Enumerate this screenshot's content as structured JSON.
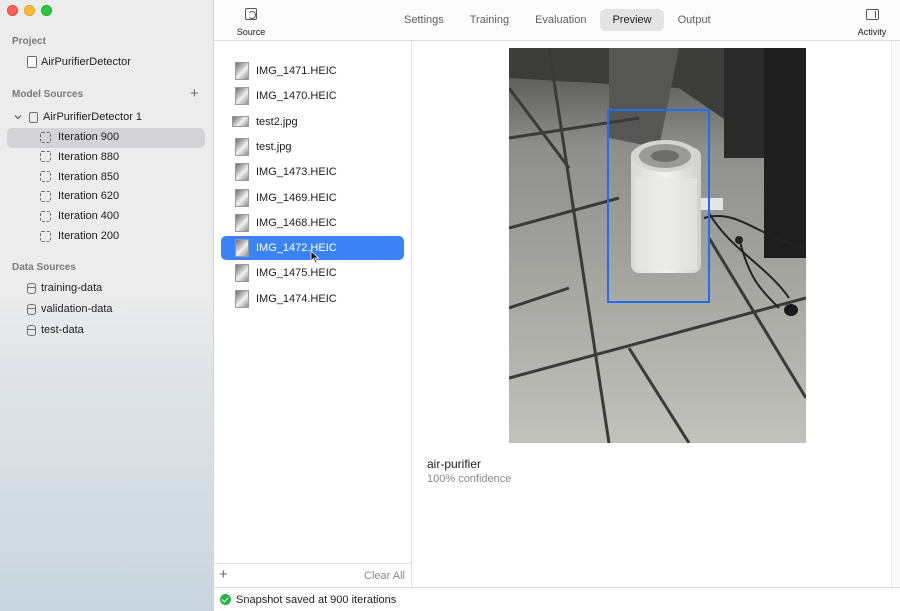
{
  "sidebar": {
    "project_title": "Project",
    "project_name": "AirPurifierDetector",
    "model_sources_title": "Model Sources",
    "add_symbol": "+",
    "model_source": "AirPurifierDetector 1",
    "iterations": [
      {
        "label": "Iteration 900",
        "selected": true
      },
      {
        "label": "Iteration 880",
        "selected": false
      },
      {
        "label": "Iteration 850",
        "selected": false
      },
      {
        "label": "Iteration 620",
        "selected": false
      },
      {
        "label": "Iteration 400",
        "selected": false
      },
      {
        "label": "Iteration 200",
        "selected": false
      }
    ],
    "data_sources_title": "Data Sources",
    "data_sources": [
      "training-data",
      "validation-data",
      "test-data"
    ]
  },
  "toolbar": {
    "source_label": "Source",
    "tabs": [
      "Settings",
      "Training",
      "Evaluation",
      "Preview",
      "Output"
    ],
    "active_tab": "Preview",
    "activity_label": "Activity"
  },
  "files": {
    "items": [
      {
        "name": "IMG_1471.HEIC",
        "selected": false
      },
      {
        "name": "IMG_1470.HEIC",
        "selected": false
      },
      {
        "name": "test2.jpg",
        "selected": false
      },
      {
        "name": "test.jpg",
        "selected": false
      },
      {
        "name": "IMG_1473.HEIC",
        "selected": false
      },
      {
        "name": "IMG_1469.HEIC",
        "selected": false
      },
      {
        "name": "IMG_1468.HEIC",
        "selected": false
      },
      {
        "name": "IMG_1472.HEIC",
        "selected": true
      },
      {
        "name": "IMG_1475.HEIC",
        "selected": false
      },
      {
        "name": "IMG_1474.HEIC",
        "selected": false
      }
    ],
    "add_symbol": "+",
    "clear_all": "Clear All"
  },
  "preview": {
    "label": "air-purifier",
    "confidence": "100% confidence",
    "box_color": "#1d6ef5"
  },
  "status": {
    "text": "Snapshot saved at 900 iterations",
    "icon": "checkmark-circle-icon",
    "color": "#28b446"
  },
  "colors": {
    "selection_blue": "#3b82f6",
    "traffic_red": "#ff5f57",
    "traffic_yellow": "#febc2e",
    "traffic_green": "#28c840"
  }
}
